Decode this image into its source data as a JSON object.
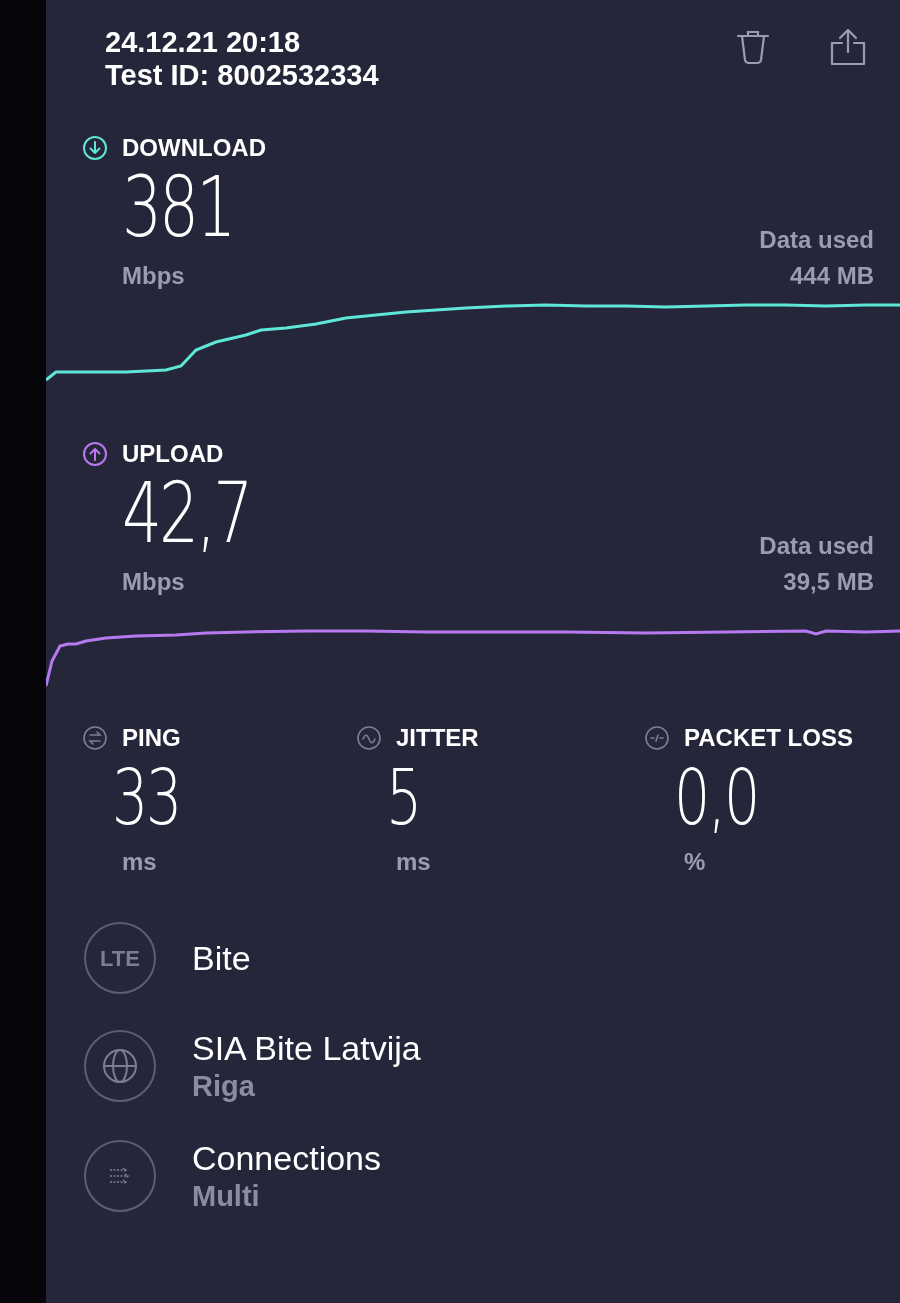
{
  "header": {
    "datetime": "24.12.21 20:18",
    "test_id": "Test ID: 8002532334"
  },
  "speeds": [
    {
      "kind": "download",
      "label": "DOWNLOAD",
      "value": "381",
      "unit": "Mbps",
      "data_label": "Data used",
      "data_value": "444 MB"
    },
    {
      "kind": "upload",
      "label": "UPLOAD",
      "value": "42,7",
      "unit": "Mbps",
      "data_label": "Data used",
      "data_value": "39,5 MB"
    }
  ],
  "metrics": [
    {
      "kind": "ping",
      "label": "PING",
      "value": "33",
      "unit": "ms"
    },
    {
      "kind": "jitter",
      "label": "JITTER",
      "value": "5",
      "unit": "ms"
    },
    {
      "kind": "loss",
      "label": "PACKET LOSS",
      "value": "0,0",
      "unit": "%"
    }
  ],
  "info": [
    {
      "kind": "lte",
      "badge": "LTE",
      "title": "Bite"
    },
    {
      "kind": "server",
      "title": "SIA Bite Latvija",
      "subtitle": "Riga"
    },
    {
      "kind": "connections",
      "title": "Connections",
      "subtitle": "Multi"
    }
  ]
}
